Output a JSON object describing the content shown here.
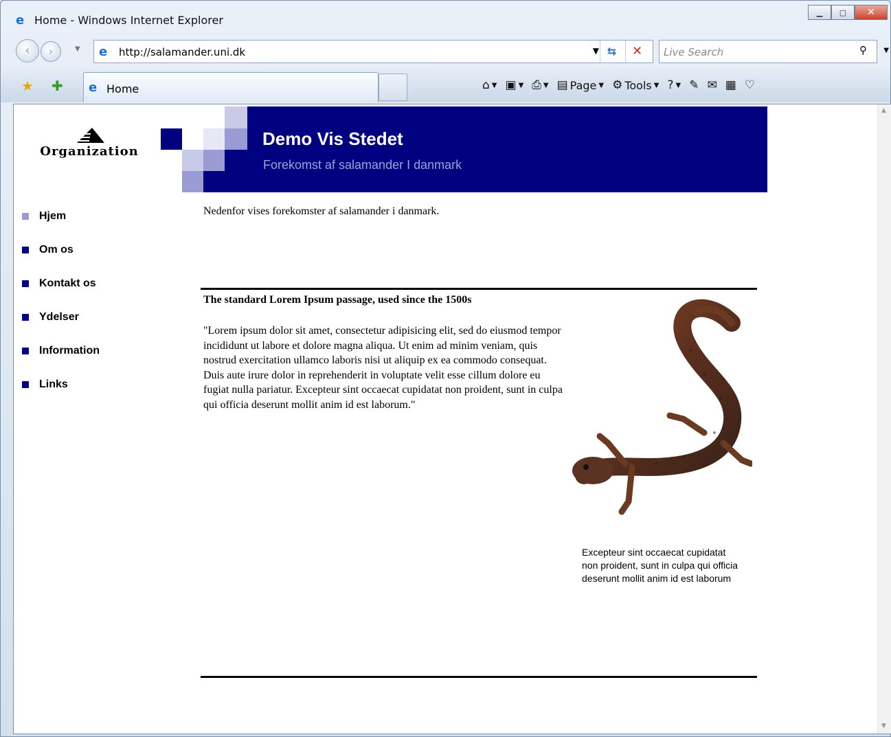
{
  "browser": {
    "window_title": "Home - Windows Internet Explorer",
    "address_url": "http://salamander.uni.dk",
    "search_placeholder": "Live Search",
    "tab_label": "Home",
    "commands": {
      "page": "Page",
      "tools": "Tools"
    }
  },
  "site": {
    "logo_text": "Organization",
    "header_title": "Demo Vis Stedet",
    "header_subtitle": "Forekomst af salamander I danmark",
    "nav": [
      {
        "label": "Hjem",
        "active": true
      },
      {
        "label": "Om os"
      },
      {
        "label": "Kontakt os"
      },
      {
        "label": "Ydelser"
      },
      {
        "label": "Information"
      },
      {
        "label": "Links"
      }
    ],
    "intro": "Nedenfor vises forekomster af salamander i danmark.",
    "article_title": "The standard Lorem Ipsum passage, used since the 1500s",
    "article_body": "\"Lorem ipsum dolor sit amet, consectetur adipisicing elit, sed do eiusmod tempor incididunt ut labore et dolore magna aliqua. Ut enim ad minim veniam, quis nostrud exercitation ullamco laboris nisi ut aliquip ex ea commodo consequat. Duis aute irure dolor in reprehenderit in voluptate velit esse cillum dolore eu fugiat nulla pariatur. Excepteur sint occaecat cupidatat non proident, sunt in culpa qui officia deserunt mollit anim id est laborum.\"",
    "caption": "Excepteur sint occaecat cupidatat non proident, sunt in culpa qui officia deserunt mollit anim id est laborum"
  },
  "colors": {
    "header_navy": "#000080",
    "nav_bullet": "#000080",
    "nav_bullet_active": "#9a9ad4"
  }
}
